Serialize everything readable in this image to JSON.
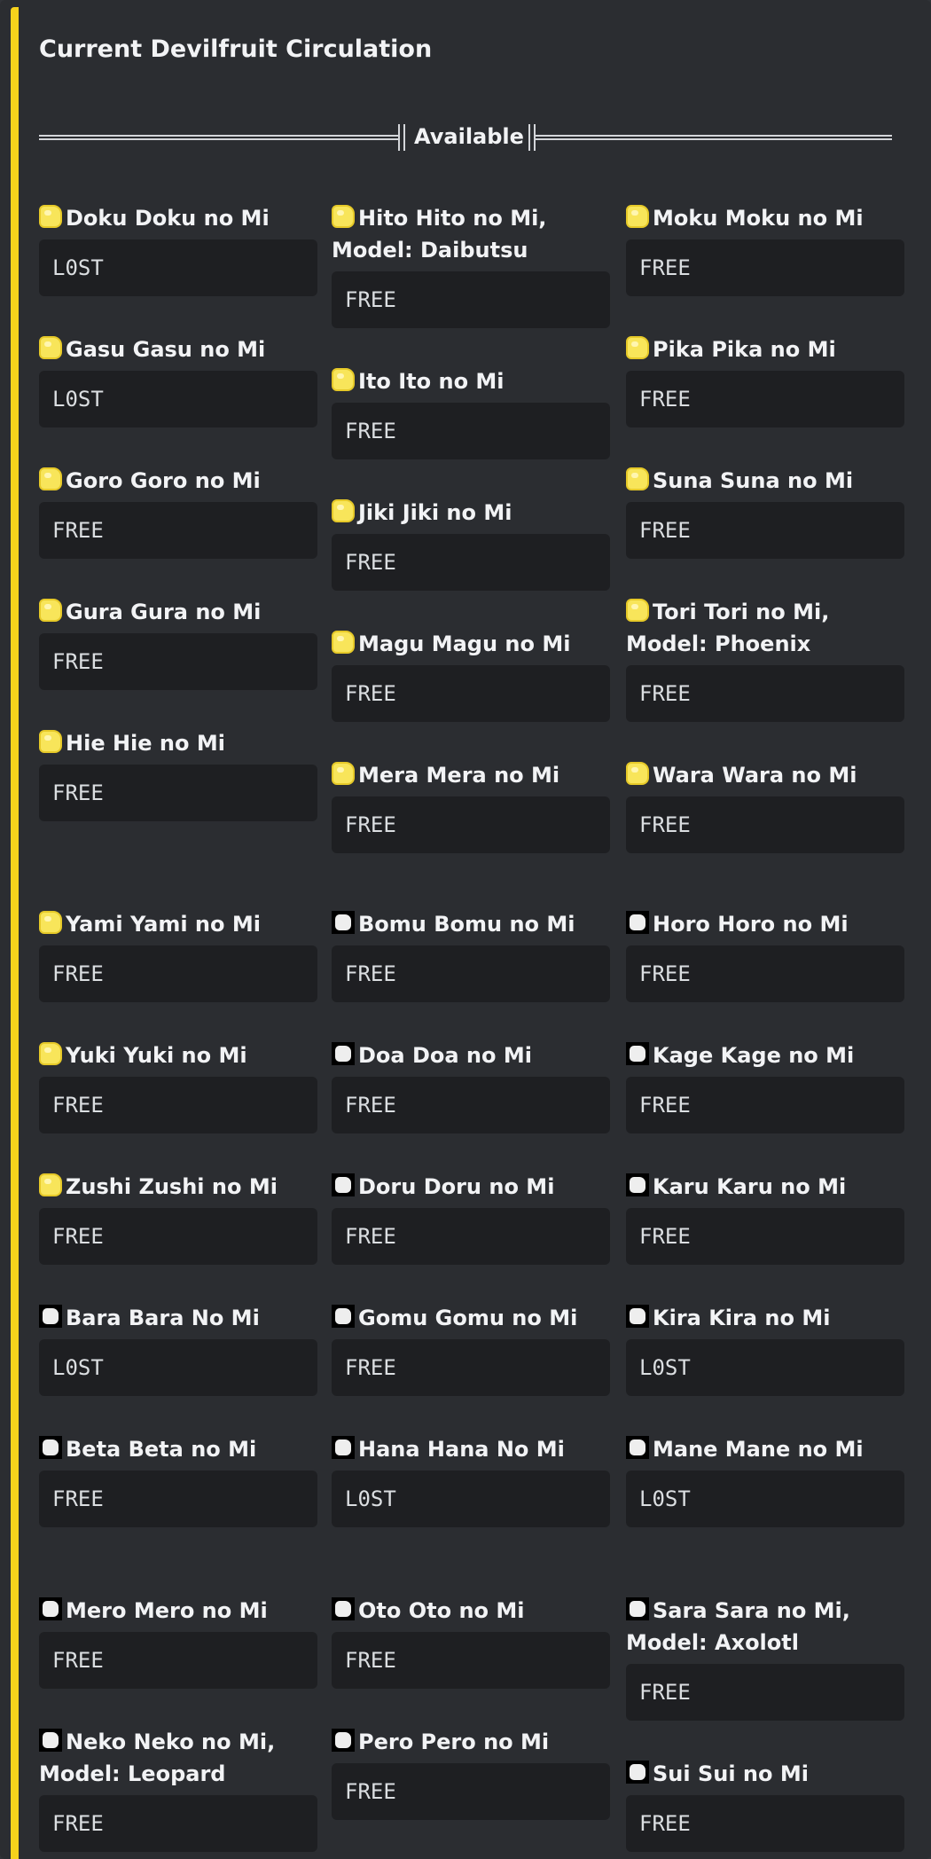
{
  "embed": {
    "accent_color": "#f6d21c",
    "title": "Current Devilfruit Circulation",
    "divider_label": "Available"
  },
  "fields": [
    {
      "name": "Doku Doku no Mi",
      "value": "L0ST",
      "icon": "yellow-devil-fruit-icon"
    },
    {
      "name": "Hito Hito no Mi, Model: Daibutsu",
      "value": "FREE",
      "icon": "yellow-devil-fruit-icon"
    },
    {
      "name": "Moku Moku no Mi",
      "value": "FREE",
      "icon": "yellow-devil-fruit-icon"
    },
    {
      "name": "Gasu Gasu no Mi",
      "value": "L0ST",
      "icon": "yellow-devil-fruit-icon"
    },
    {
      "name": "Ito Ito no Mi",
      "value": "FREE",
      "icon": "yellow-devil-fruit-icon"
    },
    {
      "name": "Pika Pika no Mi",
      "value": "FREE",
      "icon": "yellow-devil-fruit-icon"
    },
    {
      "name": "Goro Goro no Mi",
      "value": "FREE",
      "icon": "yellow-devil-fruit-icon"
    },
    {
      "name": "Jiki Jiki no Mi",
      "value": "FREE",
      "icon": "yellow-devil-fruit-icon"
    },
    {
      "name": "Suna Suna no Mi",
      "value": "FREE",
      "icon": "yellow-devil-fruit-icon"
    },
    {
      "name": "Gura Gura no Mi",
      "value": "FREE",
      "icon": "yellow-devil-fruit-icon"
    },
    {
      "name": "Magu Magu no Mi",
      "value": "FREE",
      "icon": "yellow-devil-fruit-icon"
    },
    {
      "name": "Tori Tori no Mi, Model: Phoenix",
      "value": "FREE",
      "icon": "yellow-devil-fruit-icon"
    },
    {
      "name": "Hie Hie no Mi",
      "value": "FREE",
      "icon": "yellow-devil-fruit-icon"
    },
    {
      "name": "Mera Mera no Mi",
      "value": "FREE",
      "icon": "yellow-devil-fruit-icon"
    },
    {
      "name": "Wara Wara no Mi",
      "value": "FREE",
      "icon": "yellow-devil-fruit-icon"
    },
    {
      "name": "Yami Yami no Mi",
      "value": "FREE",
      "icon": "yellow-devil-fruit-icon"
    },
    {
      "name": "Bomu Bomu no Mi",
      "value": "FREE",
      "icon": "white-devil-fruit-icon"
    },
    {
      "name": "Horo Horo no Mi",
      "value": "FREE",
      "icon": "white-devil-fruit-icon"
    },
    {
      "name": "Yuki Yuki no Mi",
      "value": "FREE",
      "icon": "yellow-devil-fruit-icon"
    },
    {
      "name": "Doa Doa no Mi",
      "value": "FREE",
      "icon": "white-devil-fruit-icon"
    },
    {
      "name": "Kage Kage no Mi",
      "value": "FREE",
      "icon": "white-devil-fruit-icon"
    },
    {
      "name": "Zushi Zushi no Mi",
      "value": "FREE",
      "icon": "yellow-devil-fruit-icon"
    },
    {
      "name": "Doru Doru no Mi",
      "value": "FREE",
      "icon": "white-devil-fruit-icon"
    },
    {
      "name": "Karu Karu no Mi",
      "value": "FREE",
      "icon": "white-devil-fruit-icon"
    },
    {
      "name": "Bara Bara No Mi",
      "value": "L0ST",
      "icon": "white-devil-fruit-icon"
    },
    {
      "name": "Gomu Gomu no Mi",
      "value": "FREE",
      "icon": "white-devil-fruit-icon"
    },
    {
      "name": "Kira Kira no Mi",
      "value": "L0ST",
      "icon": "white-devil-fruit-icon"
    },
    {
      "name": "Beta Beta no Mi",
      "value": "FREE",
      "icon": "white-devil-fruit-icon"
    },
    {
      "name": "Hana Hana No Mi",
      "value": "L0ST",
      "icon": "white-devil-fruit-icon"
    },
    {
      "name": "Mane Mane no Mi",
      "value": "L0ST",
      "icon": "white-devil-fruit-icon"
    },
    {
      "name": "Mero Mero no Mi",
      "value": "FREE",
      "icon": "white-devil-fruit-icon"
    },
    {
      "name": "Oto Oto no Mi",
      "value": "FREE",
      "icon": "white-devil-fruit-icon"
    },
    {
      "name": "Sara Sara no Mi, Model: Axolotl",
      "value": "FREE",
      "icon": "white-devil-fruit-icon"
    },
    {
      "name": "Neko Neko no Mi, Model: Leopard",
      "value": "FREE",
      "icon": "white-devil-fruit-icon"
    },
    {
      "name": "Pero Pero no Mi",
      "value": "FREE",
      "icon": "white-devil-fruit-icon"
    },
    {
      "name": "Sui Sui no Mi",
      "value": "FREE",
      "icon": "white-devil-fruit-icon"
    }
  ]
}
